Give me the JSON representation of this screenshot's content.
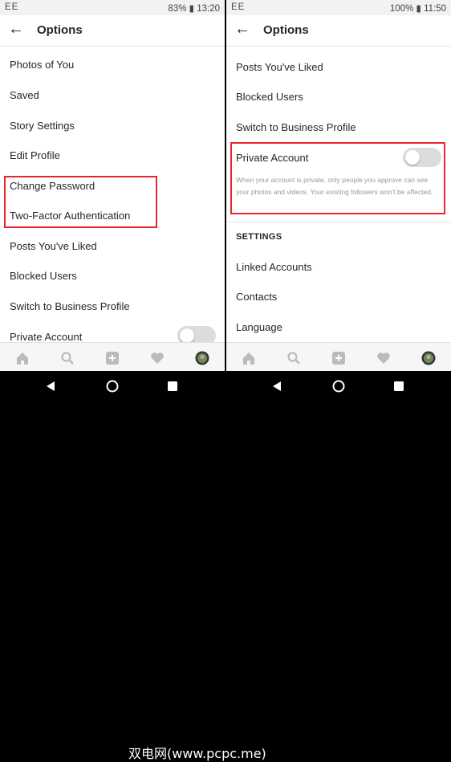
{
  "left": {
    "status": {
      "carrier": "EE",
      "battery": "83%",
      "time": "13:20"
    },
    "title": "Options",
    "items": [
      "Photos of You",
      "Saved",
      "Story Settings",
      "Edit Profile",
      "Change Password",
      "Two-Factor Authentication",
      "Posts You've Liked",
      "Blocked Users",
      "Switch to Business Profile",
      "Private Account"
    ]
  },
  "right": {
    "status": {
      "carrier": "EE",
      "battery": "100%",
      "time": "11:50"
    },
    "title": "Options",
    "items": [
      "Posts You've Liked",
      "Blocked Users",
      "Switch to Business Profile"
    ],
    "private": {
      "label": "Private Account",
      "description": "When your account is private, only people you approve can see your photos and videos. Your existing followers won't be affected."
    },
    "section_header": "SETTINGS",
    "settings_items": [
      "Linked Accounts",
      "Contacts",
      "Language"
    ]
  },
  "watermark": "双电网(www.pcpc.me)",
  "icons": [
    "back-arrow-icon",
    "home-icon",
    "search-icon",
    "add-icon",
    "heart-icon",
    "profile-icon",
    "back-triangle-icon",
    "home-circle-icon",
    "recents-square-icon"
  ],
  "colors": {
    "highlight": "#e8262b",
    "toggle_off": "#dcdcdc"
  }
}
